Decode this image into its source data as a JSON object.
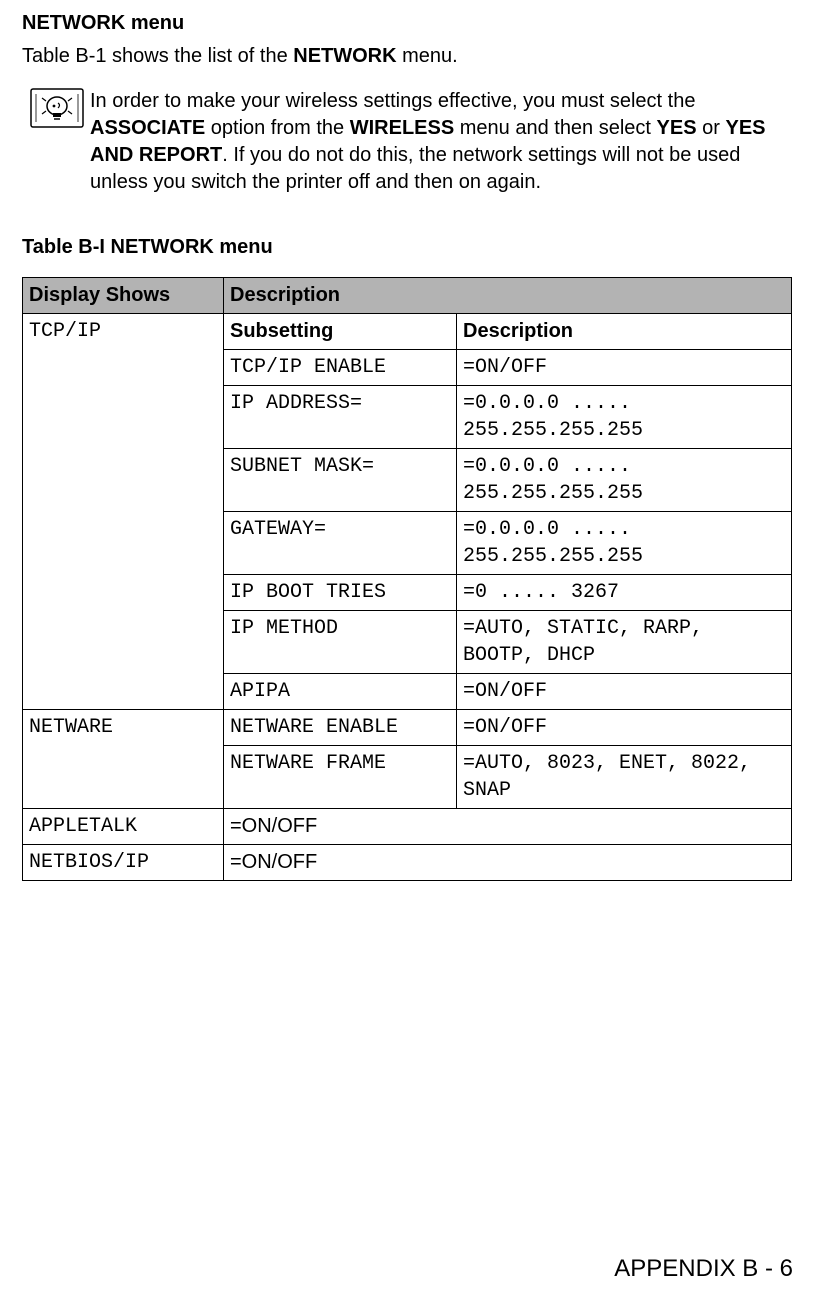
{
  "section": {
    "heading": "NETWORK menu",
    "intro_pre": "Table B-1 shows the list of the ",
    "intro_bold": "NETWORK",
    "intro_post": " menu."
  },
  "note": {
    "seg1": "In order to make your wireless settings effective, you must select the ",
    "assoc": "ASSOCIATE",
    "seg2": " option from the ",
    "wireless": "WIRELESS",
    "seg3": " menu and then select ",
    "yes": "YES",
    "seg4": " or ",
    "yes_report": "YES AND REPORT",
    "seg5": ". If you do not do this, the network settings will not be used unless you switch the printer off and then on again."
  },
  "table_title": "Table B-I NETWORK menu",
  "table": {
    "headers": {
      "display_shows": "Display Shows",
      "description": "Description"
    },
    "tcpip": {
      "label": "TCP/IP",
      "sub_header_subsetting": "Subsetting",
      "sub_header_description": "Description",
      "rows": [
        {
          "sub": "TCP/IP ENABLE",
          "desc": "=ON/OFF"
        },
        {
          "sub": "IP ADDRESS=",
          "desc": "=0.0.0.0 ..... 255.255.255.255"
        },
        {
          "sub": "SUBNET MASK=",
          "desc": "=0.0.0.0 ..... 255.255.255.255"
        },
        {
          "sub": "GATEWAY=",
          "desc": "=0.0.0.0 ..... 255.255.255.255"
        },
        {
          "sub": "IP BOOT TRIES",
          "desc": "=0 ..... 3267"
        },
        {
          "sub": "IP METHOD",
          "desc": "=AUTO, STATIC, RARP, BOOTP, DHCP"
        },
        {
          "sub": "APIPA",
          "desc": "=ON/OFF"
        }
      ]
    },
    "netware": {
      "label": "NETWARE",
      "rows": [
        {
          "sub": "NETWARE ENABLE",
          "desc": "=ON/OFF"
        },
        {
          "sub": "NETWARE FRAME",
          "desc": "=AUTO, 8023, ENET, 8022, SNAP"
        }
      ]
    },
    "appletalk": {
      "label": "APPLETALK",
      "desc": "=ON/OFF"
    },
    "netbios": {
      "label": "NETBIOS/IP",
      "desc": "=ON/OFF"
    }
  },
  "footer": "APPENDIX B - 6"
}
